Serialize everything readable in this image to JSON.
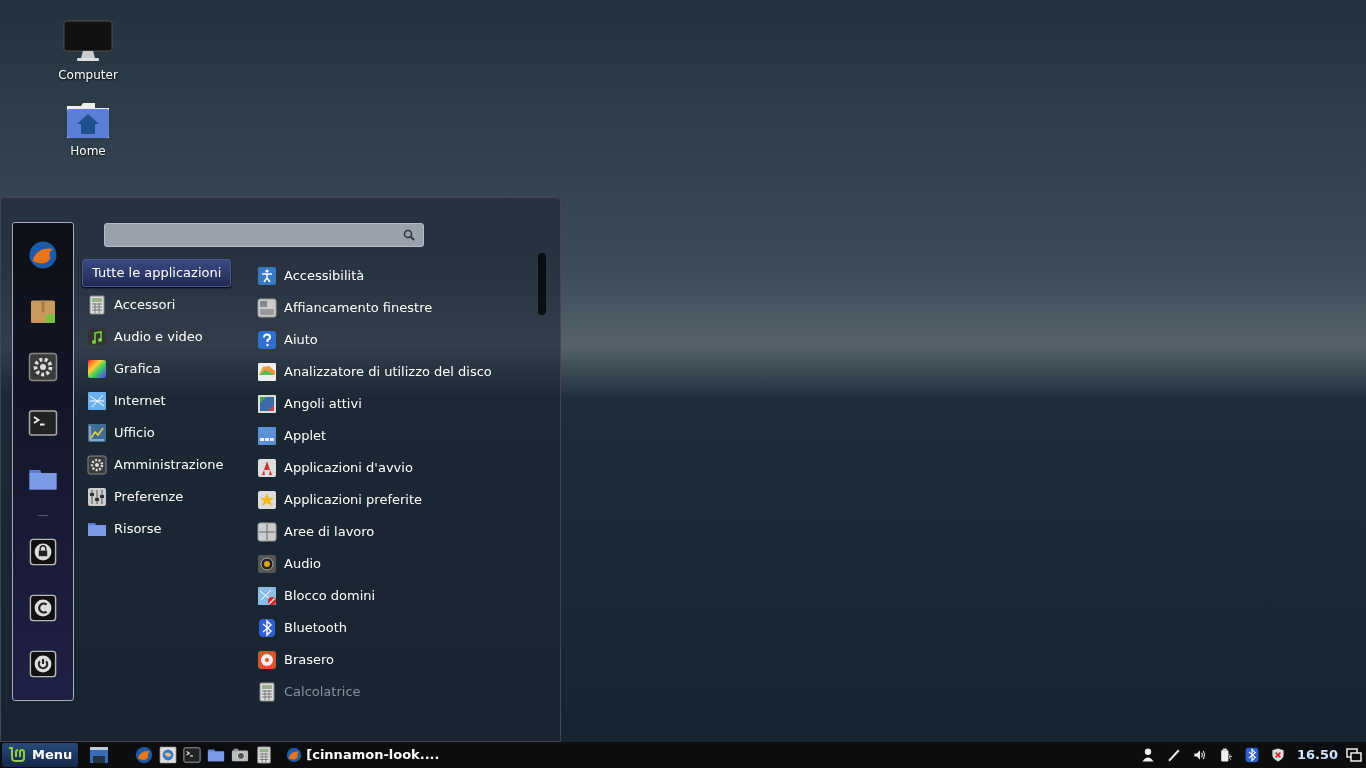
{
  "desktop_icons": [
    {
      "kind": "computer",
      "label": "Computer"
    },
    {
      "kind": "home",
      "label": "Home"
    }
  ],
  "menu": {
    "favorites": [
      {
        "kind": "browser"
      },
      {
        "kind": "package"
      },
      {
        "kind": "gear"
      },
      {
        "kind": "terminal"
      },
      {
        "kind": "folder"
      }
    ],
    "session": [
      {
        "kind": "lock"
      },
      {
        "kind": "logout"
      },
      {
        "kind": "power"
      }
    ],
    "categories": [
      {
        "kind": "all",
        "label": "Tutte le applicazioni",
        "selected": true
      },
      {
        "kind": "calculator",
        "label": "Accessori",
        "selected": false
      },
      {
        "kind": "music",
        "label": "Audio e video",
        "selected": false
      },
      {
        "kind": "rainbow",
        "label": "Grafica",
        "selected": false
      },
      {
        "kind": "globe",
        "label": "Internet",
        "selected": false
      },
      {
        "kind": "chart",
        "label": "Ufficio",
        "selected": false
      },
      {
        "kind": "gear",
        "label": "Amministrazione",
        "selected": false
      },
      {
        "kind": "sliders",
        "label": "Preferenze",
        "selected": false
      },
      {
        "kind": "folder",
        "label": "Risorse",
        "selected": false
      }
    ],
    "apps": [
      {
        "kind": "person",
        "label": "Accessibilità",
        "dimmed": false
      },
      {
        "kind": "tiles",
        "label": "Affiancamento finestre",
        "dimmed": false
      },
      {
        "kind": "help",
        "label": "Aiuto",
        "dimmed": false
      },
      {
        "kind": "disk",
        "label": "Analizzatore di utilizzo del disco",
        "dimmed": false
      },
      {
        "kind": "corners",
        "label": "Angoli attivi",
        "dimmed": false
      },
      {
        "kind": "applet",
        "label": "Applet",
        "dimmed": false
      },
      {
        "kind": "rocket",
        "label": "Applicazioni d'avvio",
        "dimmed": false
      },
      {
        "kind": "star",
        "label": "Applicazioni preferite",
        "dimmed": false
      },
      {
        "kind": "grid",
        "label": "Aree di lavoro",
        "dimmed": false
      },
      {
        "kind": "speaker",
        "label": "Audio",
        "dimmed": false
      },
      {
        "kind": "block",
        "label": "Blocco domini",
        "dimmed": false
      },
      {
        "kind": "bluetooth",
        "label": "Bluetooth",
        "dimmed": false
      },
      {
        "kind": "disc",
        "label": "Brasero",
        "dimmed": false
      },
      {
        "kind": "calculator",
        "label": "Calcolatrice",
        "dimmed": true
      }
    ]
  },
  "taskbar": {
    "menu_button": "Menu",
    "launchers": [
      {
        "kind": "browser"
      },
      {
        "kind": "mail"
      },
      {
        "kind": "terminal"
      },
      {
        "kind": "folder"
      },
      {
        "kind": "camera"
      },
      {
        "kind": "calculator"
      }
    ],
    "windows": [
      {
        "label": "[cinnamon-look....",
        "kind": "browser"
      }
    ],
    "tray": [
      {
        "kind": "user"
      },
      {
        "kind": "pen"
      },
      {
        "kind": "volume"
      },
      {
        "kind": "battery"
      },
      {
        "kind": "bluetooth"
      },
      {
        "kind": "shield"
      }
    ],
    "clock": "16.50"
  }
}
